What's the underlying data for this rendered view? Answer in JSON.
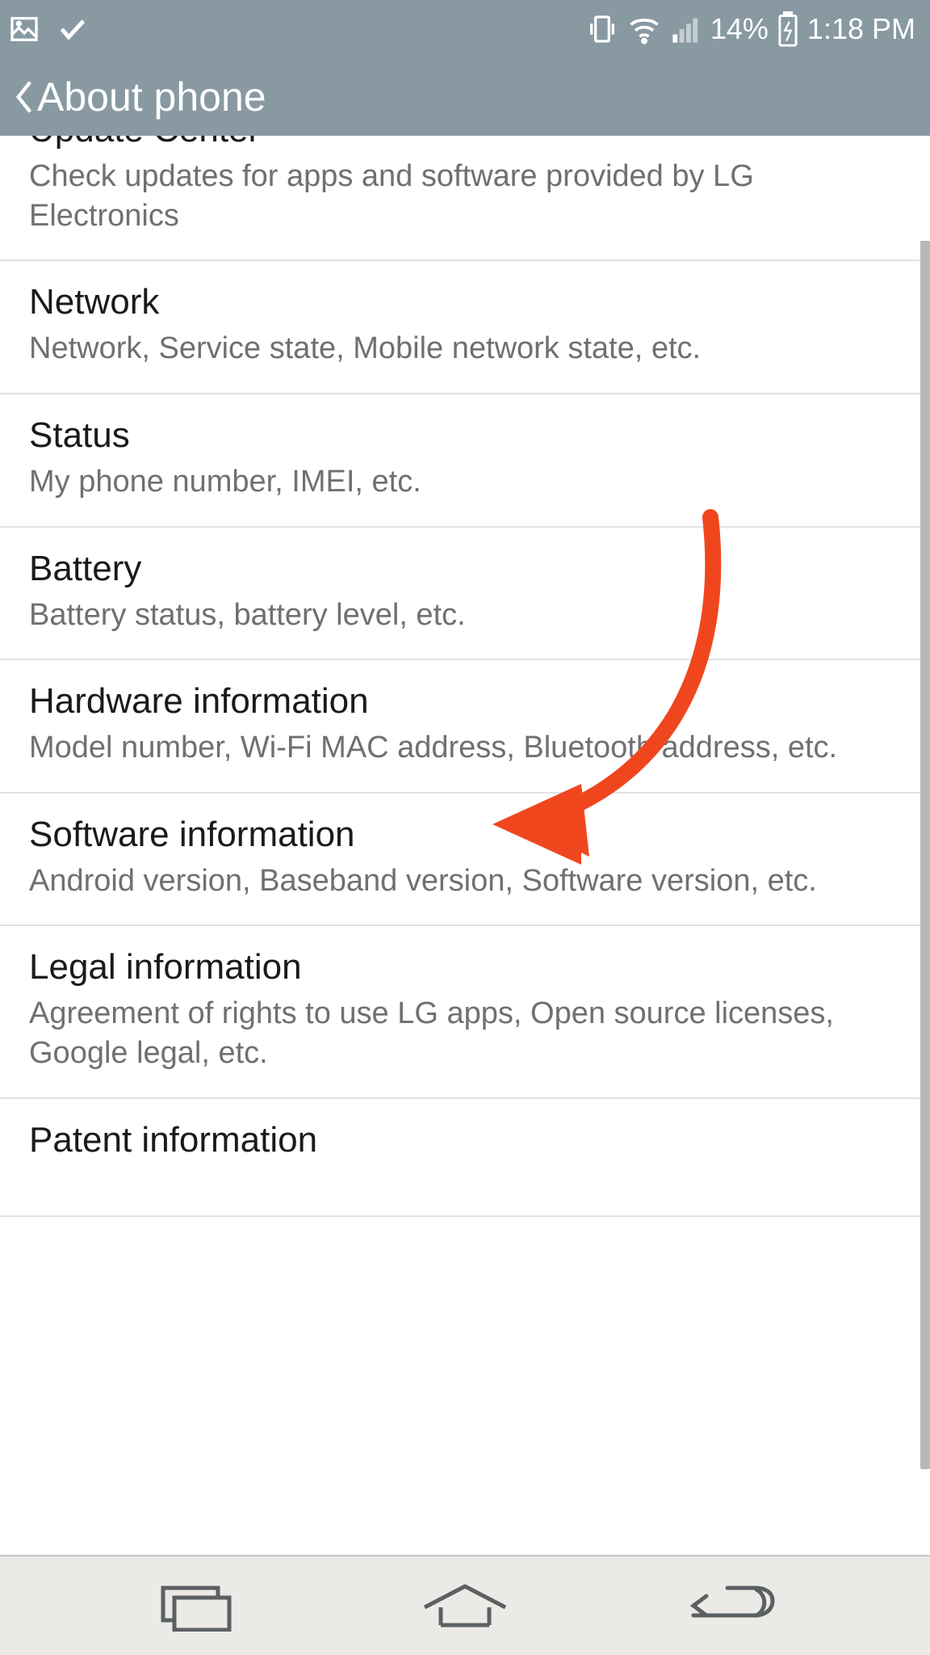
{
  "status_bar": {
    "battery_percent": "14%",
    "time": "1:18 PM"
  },
  "header": {
    "title": "About phone"
  },
  "list": [
    {
      "title": "Update Center",
      "desc": "Check updates for apps and software provided by LG Electronics"
    },
    {
      "title": "Network",
      "desc": "Network, Service state, Mobile network state, etc."
    },
    {
      "title": "Status",
      "desc": "My phone number, IMEI, etc."
    },
    {
      "title": "Battery",
      "desc": "Battery status, battery level, etc."
    },
    {
      "title": "Hardware information",
      "desc": "Model number, Wi-Fi MAC address, Bluetooth address, etc."
    },
    {
      "title": "Software information",
      "desc": "Android version, Baseband version, Software version, etc."
    },
    {
      "title": "Legal information",
      "desc": "Agreement of rights to use LG apps, Open source licenses, Google legal, etc."
    },
    {
      "title": "Patent information",
      "desc": ""
    }
  ],
  "annotation": {
    "arrow_color": "#f0461e",
    "target": "hardware-information"
  }
}
